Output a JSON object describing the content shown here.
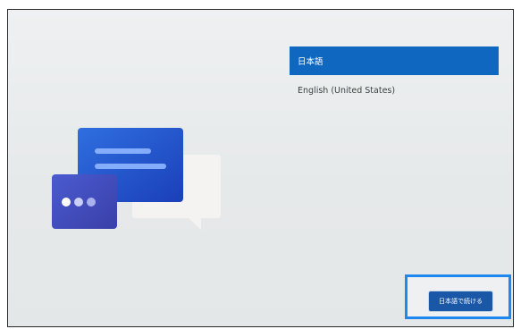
{
  "language_list": {
    "items": [
      {
        "label": "日本語",
        "selected": true
      },
      {
        "label": "English (United States)",
        "selected": false
      }
    ]
  },
  "footer": {
    "continue_label": "日本語で続ける"
  },
  "colors": {
    "accent": "#0f67c0",
    "button": "#1a57a6",
    "focus_outline": "#1e87f0",
    "background": "#e8ebec"
  },
  "illustration": {
    "icon": "chat-bubbles-icon"
  }
}
